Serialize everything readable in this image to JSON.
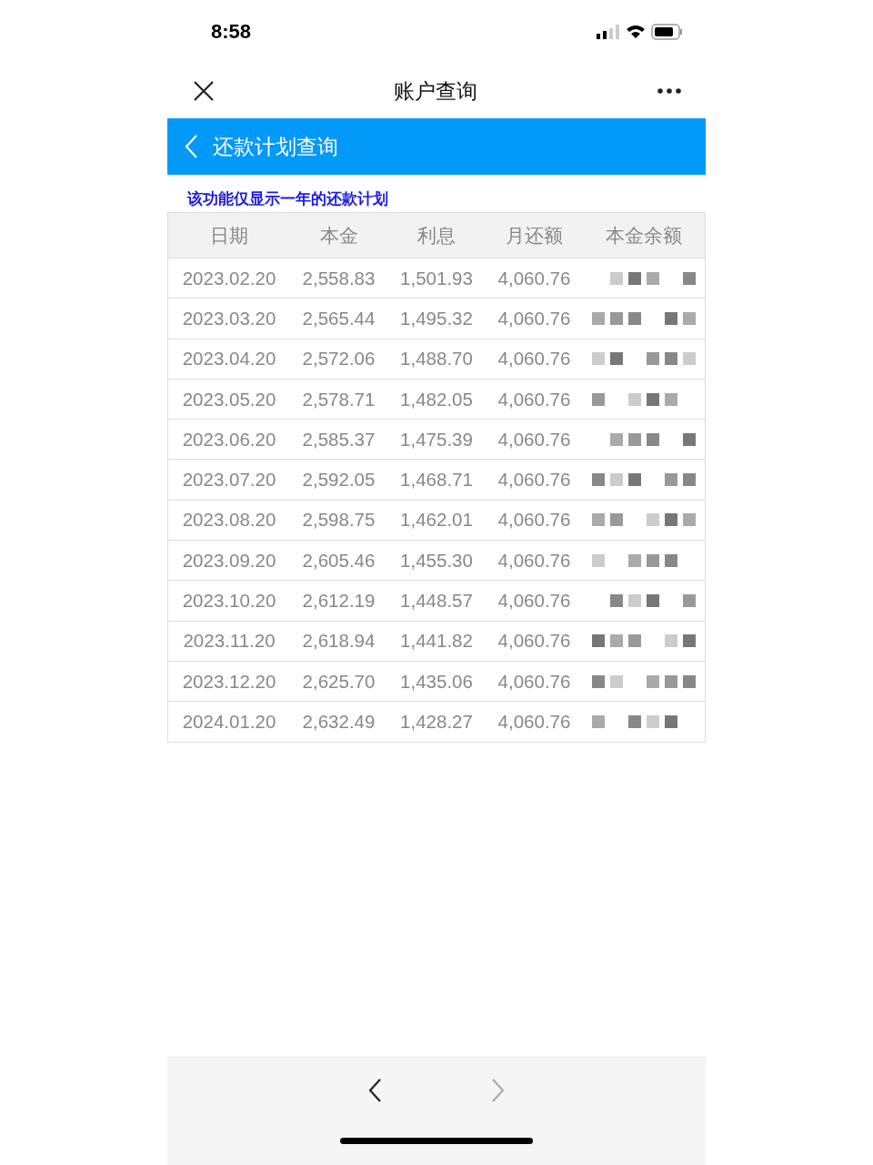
{
  "status_bar": {
    "time": "8:58"
  },
  "nav_bar": {
    "title": "账户查询"
  },
  "header": {
    "title": "还款计划查询"
  },
  "notice": "该功能仅显示一年的还款计划",
  "table": {
    "columns": [
      "日期",
      "本金",
      "利息",
      "月还额",
      "本金余额"
    ],
    "rows": [
      {
        "date": "2023.02.20",
        "principal": "2,558.83",
        "interest": "1,501.93",
        "payment": "4,060.76",
        "balance_redacted": true
      },
      {
        "date": "2023.03.20",
        "principal": "2,565.44",
        "interest": "1,495.32",
        "payment": "4,060.76",
        "balance_redacted": true
      },
      {
        "date": "2023.04.20",
        "principal": "2,572.06",
        "interest": "1,488.70",
        "payment": "4,060.76",
        "balance_redacted": true
      },
      {
        "date": "2023.05.20",
        "principal": "2,578.71",
        "interest": "1,482.05",
        "payment": "4,060.76",
        "balance_redacted": true
      },
      {
        "date": "2023.06.20",
        "principal": "2,585.37",
        "interest": "1,475.39",
        "payment": "4,060.76",
        "balance_redacted": true
      },
      {
        "date": "2023.07.20",
        "principal": "2,592.05",
        "interest": "1,468.71",
        "payment": "4,060.76",
        "balance_redacted": true
      },
      {
        "date": "2023.08.20",
        "principal": "2,598.75",
        "interest": "1,462.01",
        "payment": "4,060.76",
        "balance_redacted": true
      },
      {
        "date": "2023.09.20",
        "principal": "2,605.46",
        "interest": "1,455.30",
        "payment": "4,060.76",
        "balance_redacted": true
      },
      {
        "date": "2023.10.20",
        "principal": "2,612.19",
        "interest": "1,448.57",
        "payment": "4,060.76",
        "balance_redacted": true
      },
      {
        "date": "2023.11.20",
        "principal": "2,618.94",
        "interest": "1,441.82",
        "payment": "4,060.76",
        "balance_redacted": true
      },
      {
        "date": "2023.12.20",
        "principal": "2,625.70",
        "interest": "1,435.06",
        "payment": "4,060.76",
        "balance_redacted": true
      },
      {
        "date": "2024.01.20",
        "principal": "2,632.49",
        "interest": "1,428.27",
        "payment": "4,060.76",
        "balance_redacted": true
      }
    ]
  },
  "bottom_bar": {
    "back": {
      "disabled": false
    },
    "forward": {
      "disabled": true
    }
  }
}
